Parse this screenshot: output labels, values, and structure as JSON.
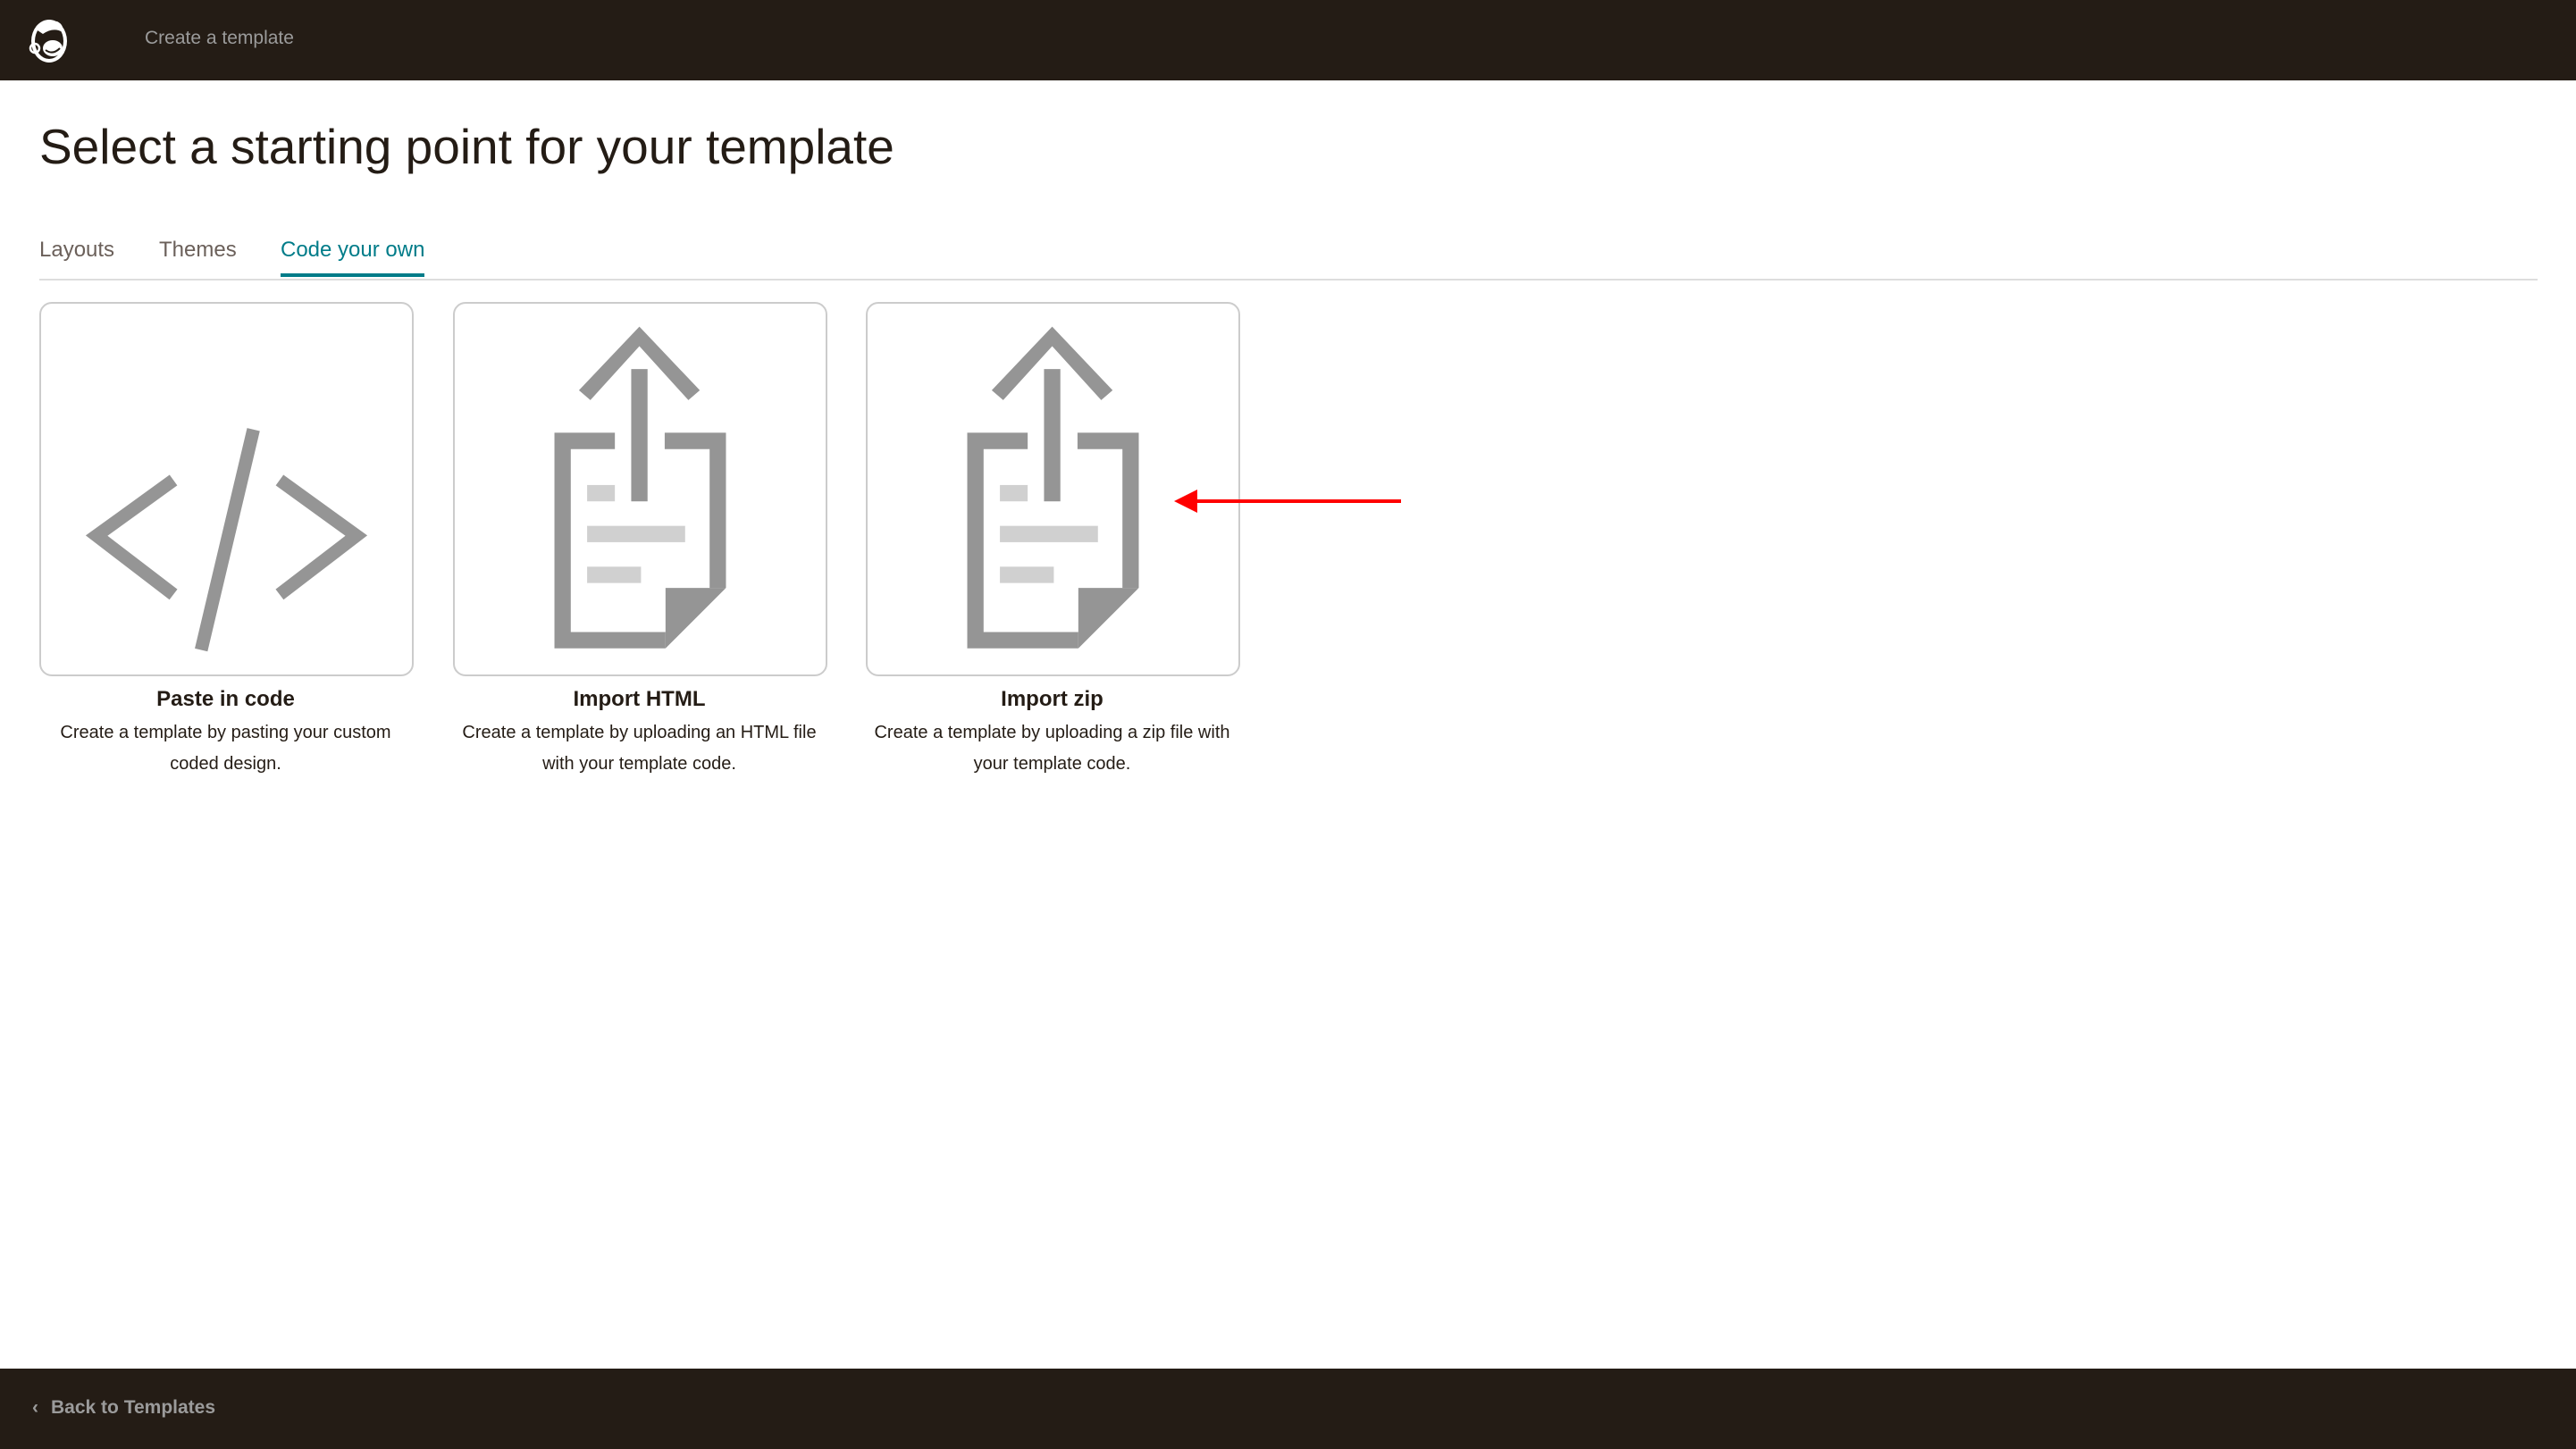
{
  "header": {
    "title": "Create a template",
    "logo": "mailchimp-freddie-logo"
  },
  "page_title": "Select a starting point for your template",
  "tabs": [
    {
      "label": "Layouts",
      "active": false
    },
    {
      "label": "Themes",
      "active": false
    },
    {
      "label": "Code your own",
      "active": true
    }
  ],
  "cards": [
    {
      "title": "Paste in code",
      "description": "Create a template by pasting your custom coded design.",
      "icon": "code-icon"
    },
    {
      "title": "Import HTML",
      "description": "Create a template by uploading an HTML file with your template code.",
      "icon": "upload-document-icon"
    },
    {
      "title": "Import zip",
      "description": "Create a template by uploading a zip file with your template code.",
      "icon": "upload-document-icon"
    }
  ],
  "footer": {
    "back_label": "Back to Templates"
  },
  "colors": {
    "dark": "#241c15",
    "accent": "#007c89",
    "icon_gray": "#959595",
    "annotation": "#ff0000"
  }
}
